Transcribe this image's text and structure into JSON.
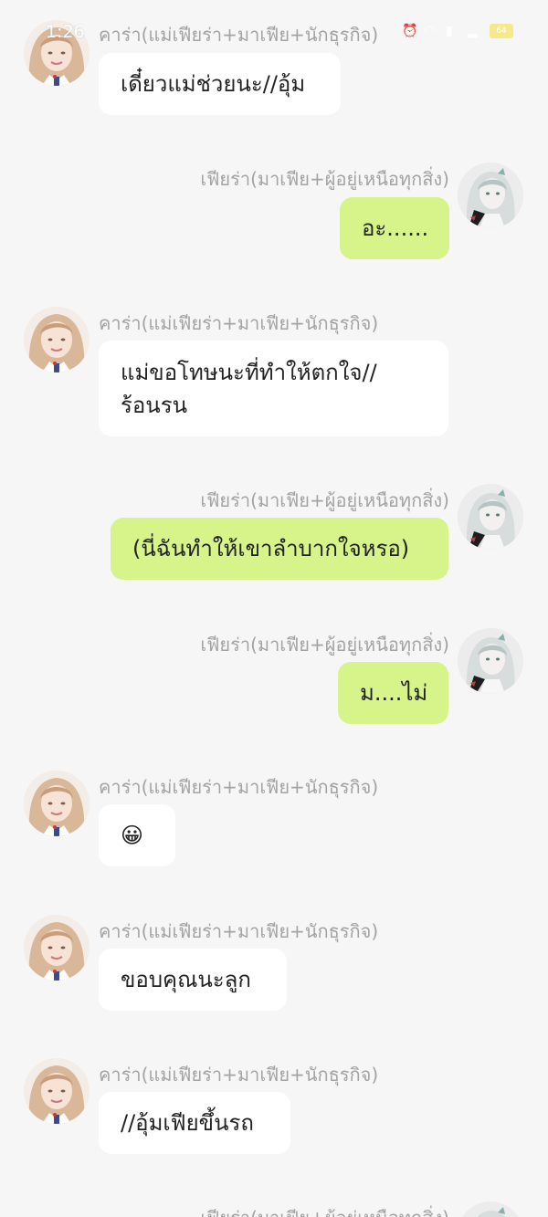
{
  "status_bar": {
    "time": "1:26",
    "battery": "64"
  },
  "icons": {
    "sender_a_avatar": "avatar-girl-icon",
    "sender_b_avatar": "avatar-silver-hair-icon"
  },
  "colors": {
    "left_bubble": "#ffffff",
    "right_bubble": "#d7f48a",
    "background": "#f6f6f6",
    "name_text": "#a3a3a3"
  },
  "chat": {
    "messages": [
      {
        "side": "left",
        "sender": "คาร่า(แม่เฟียร่า+มาเฟีย+นักธุรกิจ)",
        "text": "เดี๋ยวแม่ช่วยนะ//อุ้ม"
      },
      {
        "side": "right",
        "sender": "เฟียร่า(มาเฟีย+ผู้อยู่เหนือทุกสิ่ง)",
        "text": "อะ......"
      },
      {
        "side": "left",
        "sender": "คาร่า(แม่เฟียร่า+มาเฟีย+นักธุรกิจ)",
        "text": "แม่ขอโทษนะที่ทำให้ตกใจ//\nร้อนรน"
      },
      {
        "side": "right",
        "sender": "เฟียร่า(มาเฟีย+ผู้อยู่เหนือทุกสิ่ง)",
        "text": "(นี่ฉันทำให้เขาลำบากใจหรอ)"
      },
      {
        "side": "right",
        "sender": "เฟียร่า(มาเฟีย+ผู้อยู่เหนือทุกสิ่ง)",
        "text": "ม....ไม่"
      },
      {
        "side": "left",
        "sender": "คาร่า(แม่เฟียร่า+มาเฟีย+นักธุรกิจ)",
        "text": "😀"
      },
      {
        "side": "left",
        "sender": "คาร่า(แม่เฟียร่า+มาเฟีย+นักธุรกิจ)",
        "text": "ขอบคุณนะลูก"
      },
      {
        "side": "left",
        "sender": "คาร่า(แม่เฟียร่า+มาเฟีย+นักธุรกิจ)",
        "text": "//อุ้มเฟียขึ้นรถ"
      },
      {
        "side": "right",
        "sender": "เฟียร่า(มาเฟีย+ผู้อยู่เหนือทุกสิ่ง)",
        "text": ""
      }
    ]
  }
}
